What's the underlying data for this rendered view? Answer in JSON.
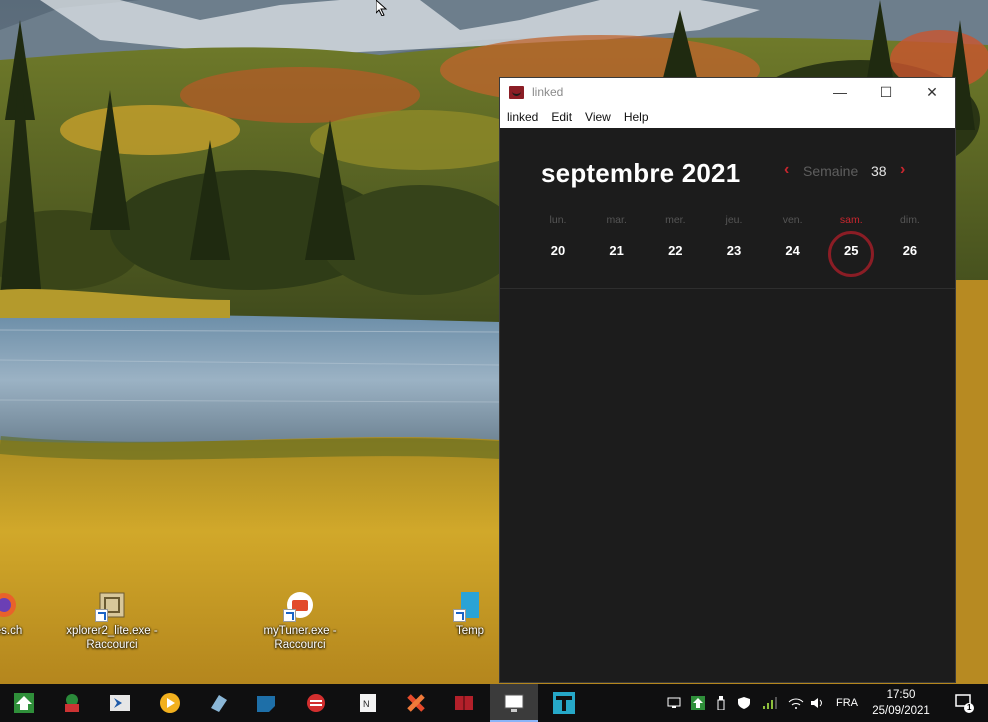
{
  "desktop": {
    "icons": [
      {
        "label": "ples.ch",
        "icon": "firefox-icon"
      },
      {
        "label": "xplorer2_lite.exe - Raccourci",
        "icon": "xplorer-icon"
      },
      {
        "label": "myTuner.exe - Raccourci",
        "icon": "mytuner-icon"
      },
      {
        "label": "Temp",
        "icon": "folder-icon"
      }
    ]
  },
  "window": {
    "title": "linked",
    "menu": [
      "linked",
      "Edit",
      "View",
      "Help"
    ],
    "controls": {
      "minimize": "—",
      "maximize": "☐",
      "close": "✕"
    }
  },
  "calendar": {
    "month_title": "septembre 2021",
    "week_label": "Semaine",
    "week_number": "38",
    "prev_arrow": "‹",
    "next_arrow": "›",
    "accent": "#c8262e",
    "days": [
      {
        "name": "lun.",
        "num": "20"
      },
      {
        "name": "mar.",
        "num": "21"
      },
      {
        "name": "mer.",
        "num": "22"
      },
      {
        "name": "jeu.",
        "num": "23"
      },
      {
        "name": "ven.",
        "num": "24"
      },
      {
        "name": "sam.",
        "num": "25",
        "selected": true
      },
      {
        "name": "dim.",
        "num": "26"
      }
    ]
  },
  "taskbar": {
    "apps": [
      "home-icon",
      "app-icon",
      "powershell-icon",
      "media-player-icon",
      "eraser-icon",
      "notes-icon",
      "stack-icon",
      "notepad-icon",
      "tools-icon",
      "linked-icon",
      "monitor-icon",
      "typora-icon"
    ],
    "tray": {
      "language": "FRA",
      "time": "17:50",
      "date": "25/09/2021",
      "notifications": "1"
    }
  }
}
